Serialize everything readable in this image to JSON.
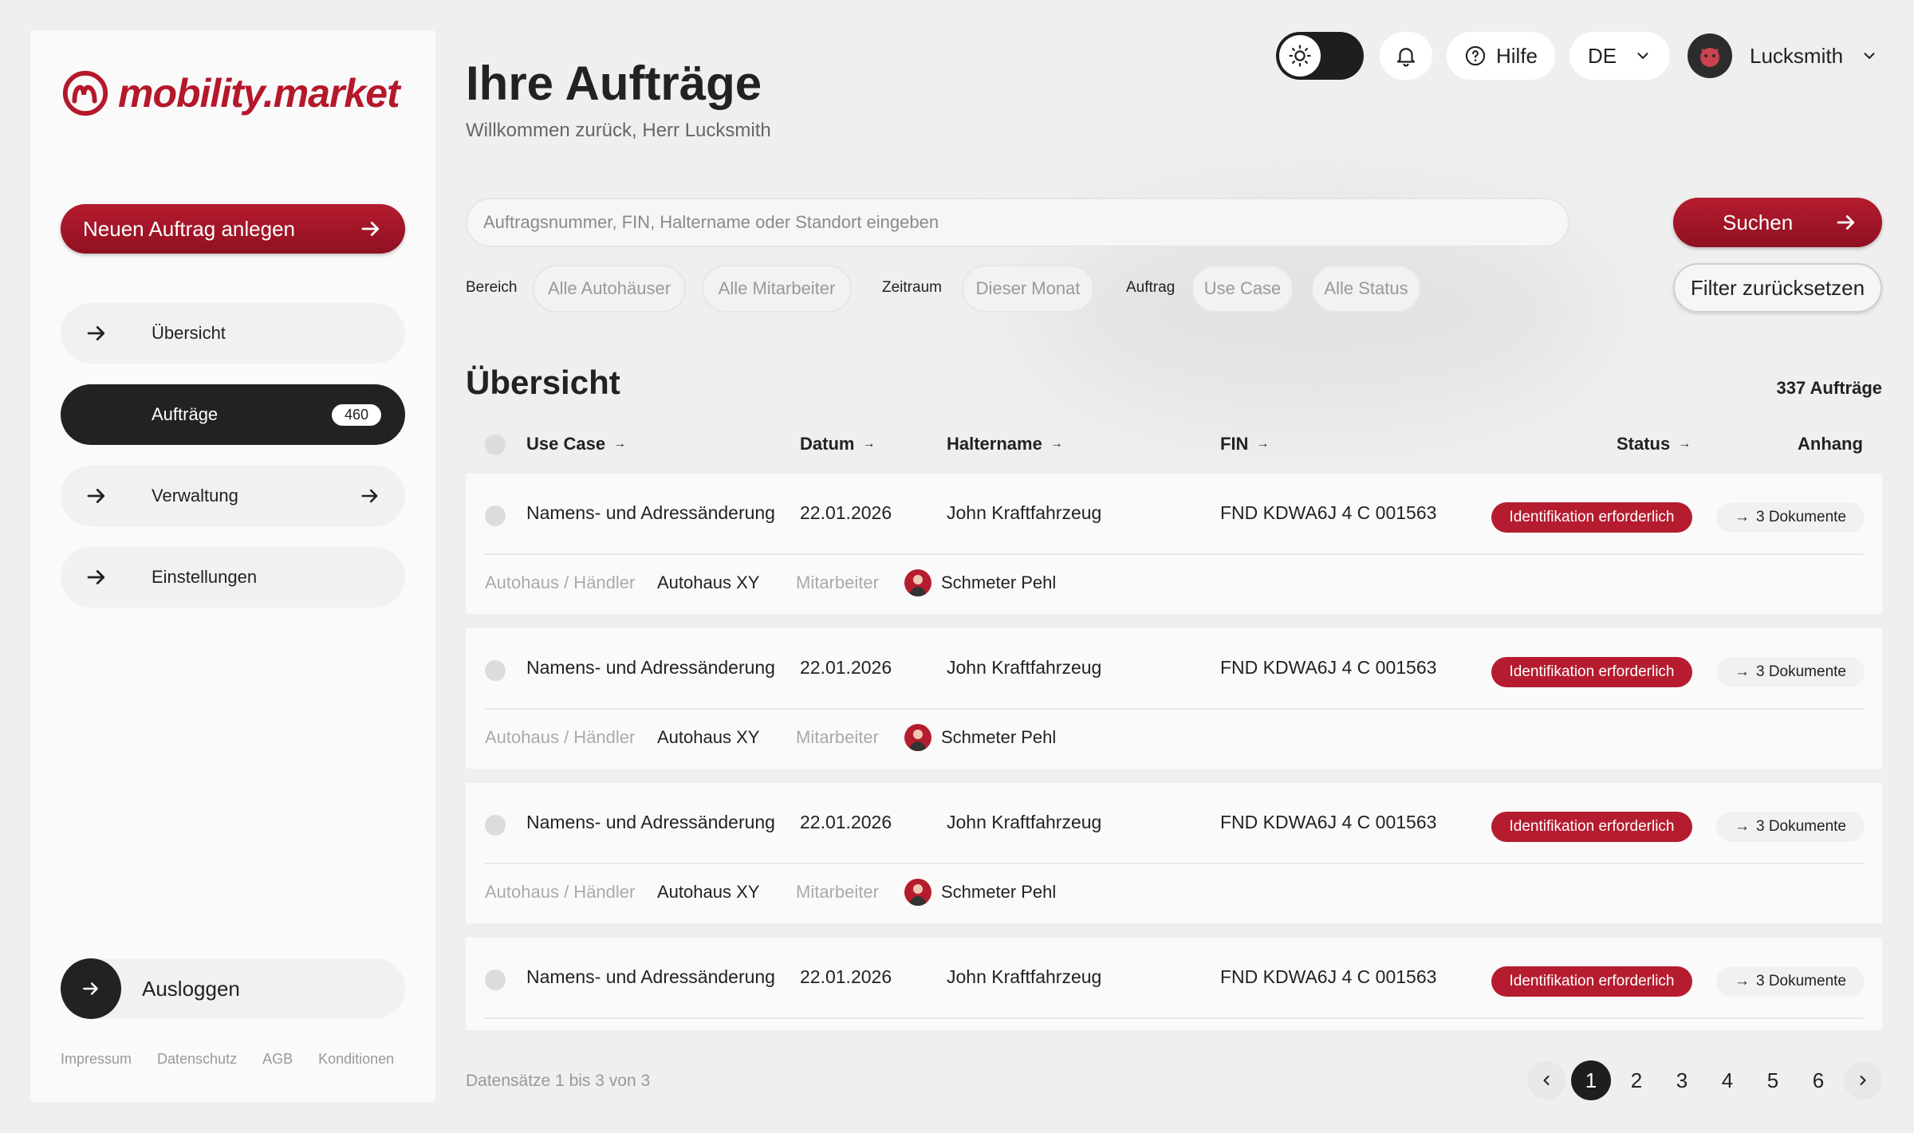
{
  "brand": {
    "name": "mobility.market",
    "color": "#b5182b"
  },
  "sidebar": {
    "new_order_label": "Neuen Auftrag anlegen",
    "items": [
      {
        "label": "Übersicht",
        "active": false
      },
      {
        "label": "Aufträge",
        "active": true,
        "badge": "460"
      },
      {
        "label": "Verwaltung",
        "active": false
      },
      {
        "label": "Einstellungen",
        "active": false
      }
    ],
    "logout_label": "Ausloggen",
    "footer": [
      "Impressum",
      "Datenschutz",
      "AGB",
      "Konditionen"
    ]
  },
  "header": {
    "title": "Ihre Aufträge",
    "subtitle": "Willkommen zurück, Herr Lucksmith",
    "help_label": "Hilfe",
    "language": "DE",
    "user_name": "Lucksmith"
  },
  "search": {
    "placeholder": "Auftragsnummer, FIN, Haltername oder Standort eingeben",
    "button_label": "Suchen",
    "reset_label": "Filter zurücksetzen"
  },
  "filters": {
    "bereich_label": "Bereich",
    "autohaeuser": "Alle Autohäuser",
    "mitarbeiter": "Alle Mitarbeiter",
    "zeitraum_label": "Zeitraum",
    "zeitraum": "Dieser Monat",
    "auftrag_label": "Auftrag",
    "use_case": "Use Case",
    "status": "Alle Status"
  },
  "overview": {
    "title": "Übersicht",
    "count": "337 Aufträge",
    "columns": {
      "use_case": "Use Case",
      "datum": "Datum",
      "haltername": "Haltername",
      "fin": "FIN",
      "status": "Status",
      "anhang": "Anhang"
    },
    "dealer_label": "Autohaus / Händler",
    "employee_label": "Mitarbeiter",
    "rows": [
      {
        "use_case": "Namens- und Adressänderung",
        "datum": "22.01.2026",
        "haltername": "John Kraftfahrzeug",
        "fin": "FND KDWA6J 4 C 001563",
        "status": "Identifikation erforderlich",
        "docs": "3 Dokumente",
        "dealer": "Autohaus XY",
        "employee": "Schmeter Pehl"
      },
      {
        "use_case": "Namens- und Adressänderung",
        "datum": "22.01.2026",
        "haltername": "John Kraftfahrzeug",
        "fin": "FND KDWA6J 4 C 001563",
        "status": "Identifikation erforderlich",
        "docs": "3 Dokumente",
        "dealer": "Autohaus XY",
        "employee": "Schmeter Pehl"
      },
      {
        "use_case": "Namens- und Adressänderung",
        "datum": "22.01.2026",
        "haltername": "John Kraftfahrzeug",
        "fin": "FND KDWA6J 4 C 001563",
        "status": "Identifikation erforderlich",
        "docs": "3 Dokumente",
        "dealer": "Autohaus XY",
        "employee": "Schmeter Pehl"
      },
      {
        "use_case": "Namens- und Adressänderung",
        "datum": "22.01.2026",
        "haltername": "John Kraftfahrzeug",
        "fin": "FND KDWA6J 4 C 001563",
        "status": "Identifikation erforderlich",
        "docs": "3 Dokumente"
      }
    ],
    "records_info": "Datensätze 1 bis 3 von 3",
    "pages": [
      "1",
      "2",
      "3",
      "4",
      "5",
      "6"
    ],
    "current_page": "1"
  }
}
